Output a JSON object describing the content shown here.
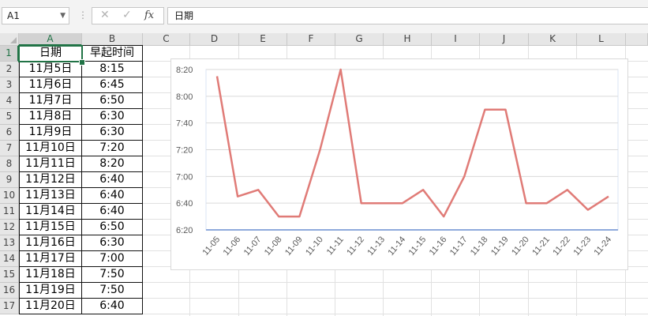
{
  "formula_bar": {
    "name_box": "A1",
    "formula": "日期"
  },
  "columns": [
    "A",
    "B",
    "C",
    "D",
    "E",
    "F",
    "G",
    "H",
    "I",
    "J",
    "K",
    "L"
  ],
  "rows": [
    "1",
    "2",
    "3",
    "4",
    "5",
    "6",
    "7",
    "8",
    "9",
    "10",
    "11",
    "12",
    "13",
    "14",
    "15",
    "16",
    "17"
  ],
  "table": {
    "headers": [
      "日期",
      "早起时间"
    ],
    "rows": [
      [
        "11月5日",
        "8:15"
      ],
      [
        "11月6日",
        "6:45"
      ],
      [
        "11月7日",
        "6:50"
      ],
      [
        "11月8日",
        "6:30"
      ],
      [
        "11月9日",
        "6:30"
      ],
      [
        "11月10日",
        "7:20"
      ],
      [
        "11月11日",
        "8:20"
      ],
      [
        "11月12日",
        "6:40"
      ],
      [
        "11月13日",
        "6:40"
      ],
      [
        "11月14日",
        "6:40"
      ],
      [
        "11月15日",
        "6:50"
      ],
      [
        "11月16日",
        "6:30"
      ],
      [
        "11月17日",
        "7:00"
      ],
      [
        "11月18日",
        "7:50"
      ],
      [
        "11月19日",
        "7:50"
      ],
      [
        "11月20日",
        "6:40"
      ]
    ]
  },
  "chart_data": {
    "type": "line",
    "title": "",
    "xlabel": "",
    "ylabel": "",
    "categories": [
      "11-05",
      "11-06",
      "11-07",
      "11-08",
      "11-09",
      "11-10",
      "11-11",
      "11-12",
      "11-13",
      "11-14",
      "11-15",
      "11-16",
      "11-17",
      "11-18",
      "11-19",
      "11-20",
      "11-21",
      "11-22",
      "11-23",
      "11-24"
    ],
    "values": [
      "8:15",
      "6:45",
      "6:50",
      "6:30",
      "6:30",
      "7:20",
      "8:20",
      "6:40",
      "6:40",
      "6:40",
      "6:50",
      "6:30",
      "7:00",
      "7:50",
      "7:50",
      "6:40",
      "6:40",
      "6:50",
      "6:35",
      "6:45"
    ],
    "y_ticks": [
      "6:20",
      "6:40",
      "7:00",
      "7:20",
      "7:40",
      "8:00",
      "8:20"
    ],
    "ylim": [
      "6:20",
      "8:20"
    ],
    "grid": true,
    "legend": "none",
    "line_color": "#e07b77",
    "axis_color": "#8faadc"
  }
}
